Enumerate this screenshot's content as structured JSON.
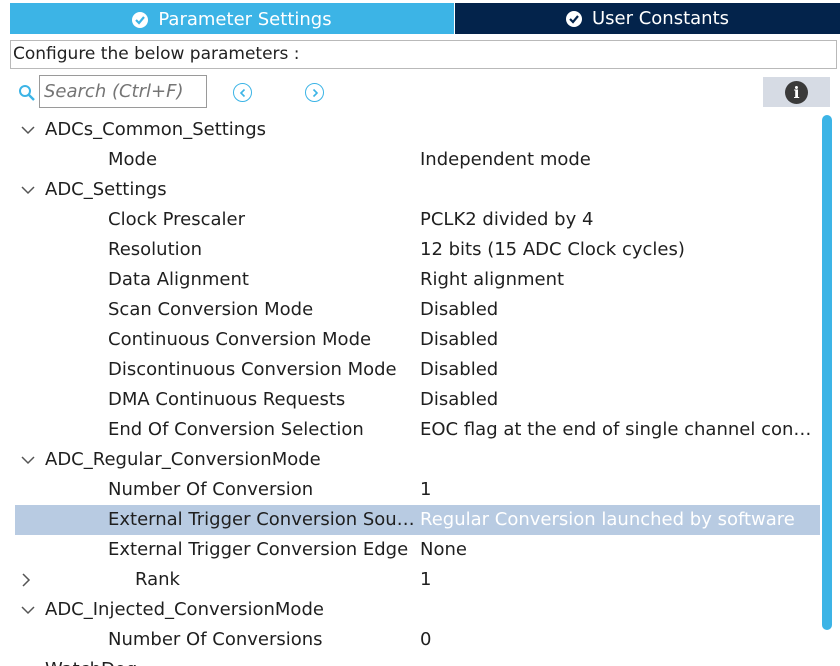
{
  "tabs": [
    {
      "label": "Parameter Settings"
    },
    {
      "label": "User Constants"
    }
  ],
  "header": {
    "configure_text": "Configure the below parameters :"
  },
  "toolbar": {
    "search_placeholder": "Search (Ctrl+F)"
  },
  "tree": {
    "group_adcs_common": "ADCs_Common_Settings",
    "mode_label": "Mode",
    "mode_value": "Independent mode",
    "group_adc_settings": "ADC_Settings",
    "clock_label": "Clock Prescaler",
    "clock_value": "PCLK2 divided by 4",
    "res_label": "Resolution",
    "res_value": "12 bits (15 ADC Clock cycles)",
    "align_label": "Data Alignment",
    "align_value": "Right alignment",
    "scan_label": "Scan Conversion Mode",
    "scan_value": "Disabled",
    "cont_label": "Continuous Conversion Mode",
    "cont_value": "Disabled",
    "disc_label": "Discontinuous Conversion Mode",
    "disc_value": "Disabled",
    "dma_label": "DMA Continuous Requests",
    "dma_value": "Disabled",
    "eoc_label": "End Of Conversion Selection",
    "eoc_value": "EOC flag at the end of single channel conv…",
    "group_regular": "ADC_Regular_ConversionMode",
    "numconv_label": "Number Of Conversion",
    "numconv_value": "1",
    "trigsrc_label": "External Trigger Conversion Sou…",
    "trigsrc_value": "Regular Conversion launched by software",
    "trigedge_label": "External Trigger Conversion Edge",
    "trigedge_value": "None",
    "rank_label": "Rank",
    "rank_value": "1",
    "group_injected": "ADC_Injected_ConversionMode",
    "numconvs_label": "Number Of Conversions",
    "numconvs_value": "0",
    "group_watchdog": "WatchDog"
  },
  "colors": {
    "accent": "#3cb4e6",
    "navy": "#03234b",
    "selection": "#b8cbe2"
  }
}
